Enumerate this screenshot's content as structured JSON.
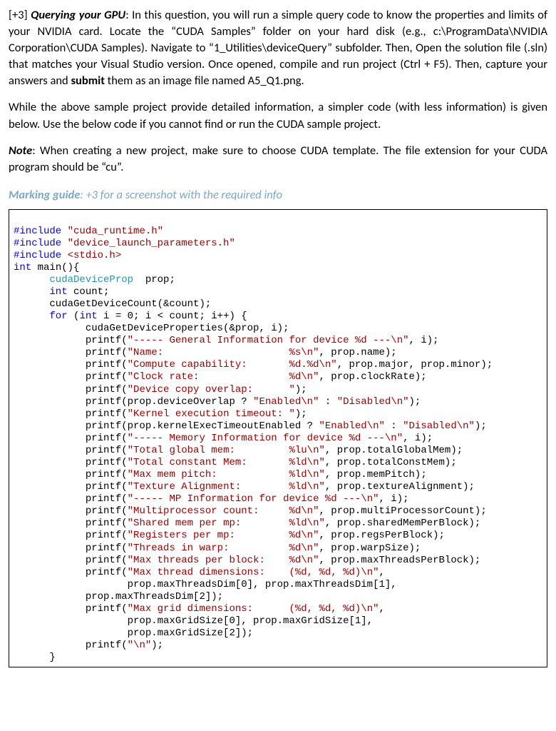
{
  "para1": {
    "lead": "[+3] ",
    "title": "Querying your GPU",
    "rest1": ": In this question, you will run a simple query code to know the properties and limits of your NVIDIA card. Locate the “CUDA Samples” folder on your hard disk (e.g., c:\\ProgramData\\NVIDIA Corporation\\CUDA Samples). Navigate to “1_Utilities\\deviceQuery” subfolder. Then, Open the solution file (.sln) that matches your Visual Studio version. Once opened, compile and run project (Ctrl + F5). Then, capture your answers and ",
    "submit": "submit",
    "rest2": " them as an image file named A5_Q1.png."
  },
  "para2": "While the above sample project provide detailed information, a simpler code (with less information) is given below. Use the below code if you cannot find or run the CUDA sample project.",
  "para3": {
    "label": "Note",
    "rest": ": When creating a new project, make sure to choose CUDA template. The file extension for your CUDA program should be “cu”."
  },
  "marking": {
    "label": "Marking guide",
    "rest": ": +3 for a screenshot with the required info"
  },
  "code": {
    "l1a": "#include ",
    "l1b": "\"cuda_runtime.h\"",
    "l2a": "#include ",
    "l2b": "\"device_launch_parameters.h\"",
    "l3a": "#include ",
    "l3b": "<stdio.h>",
    "l4a": "int ",
    "l4b": "main(){",
    "l5a": "      cudaDeviceProp",
    "l5b": "  prop;",
    "l6a": "      int",
    "l6b": " count;",
    "l7": "      cudaGetDeviceCount(&count);",
    "l8a": "      for",
    "l8b": " (",
    "l8c": "int",
    "l8d": " i = 0; i < count; i++) {",
    "l9": "            cudaGetDeviceProperties(&prop, i);",
    "l10a": "            printf(",
    "l10b": "\"----- General Information for device %d ---\\n\"",
    "l10c": ", i);",
    "l11a": "            printf(",
    "l11b": "\"Name:                     %s\\n\"",
    "l11c": ", prop.name);",
    "l12a": "            printf(",
    "l12b": "\"Compute capability:       %d.%d\\n\"",
    "l12c": ", prop.major, prop.minor);",
    "l13a": "            printf(",
    "l13b": "\"Clock rate:               %d\\n\"",
    "l13c": ", prop.clockRate);",
    "l14a": "            printf(",
    "l14b": "\"Device copy overlap:      \"",
    "l14c": ");",
    "l15a": "            printf(prop.deviceOverlap ? ",
    "l15b": "\"Enabled\\n\"",
    "l15c": " : ",
    "l15d": "\"Disabled\\n\"",
    "l15e": ");",
    "l16a": "            printf(",
    "l16b": "\"Kernel execution timeout: \"",
    "l16c": ");",
    "l17a": "            printf(prop.kernelExecTimeoutEnabled ? ",
    "l17b": "\"Enabled\\n\"",
    "l17c": " : ",
    "l17d": "\"Disabled\\n\"",
    "l17e": ");",
    "l18a": "            printf(",
    "l18b": "\"----- Memory Information for device %d ---\\n\"",
    "l18c": ", i);",
    "l19a": "            printf(",
    "l19b": "\"Total global mem:         %lu\\n\"",
    "l19c": ", prop.totalGlobalMem);",
    "l20a": "            printf(",
    "l20b": "\"Total constant Mem:       %ld\\n\"",
    "l20c": ", prop.totalConstMem);",
    "l21a": "            printf(",
    "l21b": "\"Max mem pitch:            %ld\\n\"",
    "l21c": ", prop.memPitch);",
    "l22a": "            printf(",
    "l22b": "\"Texture Alignment:        %ld\\n\"",
    "l22c": ", prop.textureAlignment);",
    "l23a": "            printf(",
    "l23b": "\"----- MP Information for device %d ---\\n\"",
    "l23c": ", i);",
    "l24a": "            printf(",
    "l24b": "\"Multiprocessor count:     %d\\n\"",
    "l24c": ", prop.multiProcessorCount);",
    "l25a": "            printf(",
    "l25b": "\"Shared mem per mp:        %ld\\n\"",
    "l25c": ", prop.sharedMemPerBlock);",
    "l26a": "            printf(",
    "l26b": "\"Registers per mp:         %d\\n\"",
    "l26c": ", prop.regsPerBlock);",
    "l27a": "            printf(",
    "l27b": "\"Threads in warp:          %d\\n\"",
    "l27c": ", prop.warpSize);",
    "l28a": "            printf(",
    "l28b": "\"Max threads per block:    %d\\n\"",
    "l28c": ", prop.maxThreadsPerBlock);",
    "l29a": "            printf(",
    "l29b": "\"Max thread dimensions:    (%d, %d, %d)\\n\"",
    "l29c": ",",
    "l30": "                   prop.maxThreadsDim[0], prop.maxThreadsDim[1],",
    "l31": "            prop.maxThreadsDim[2]);",
    "l32a": "            printf(",
    "l32b": "\"Max grid dimensions:      (%d, %d, %d)\\n\"",
    "l32c": ",",
    "l33": "                   prop.maxGridSize[0], prop.maxGridSize[1],",
    "l34": "                   prop.maxGridSize[2]);",
    "l35a": "            printf(",
    "l35b": "\"\\n\"",
    "l35c": ");",
    "l36": "      }"
  }
}
